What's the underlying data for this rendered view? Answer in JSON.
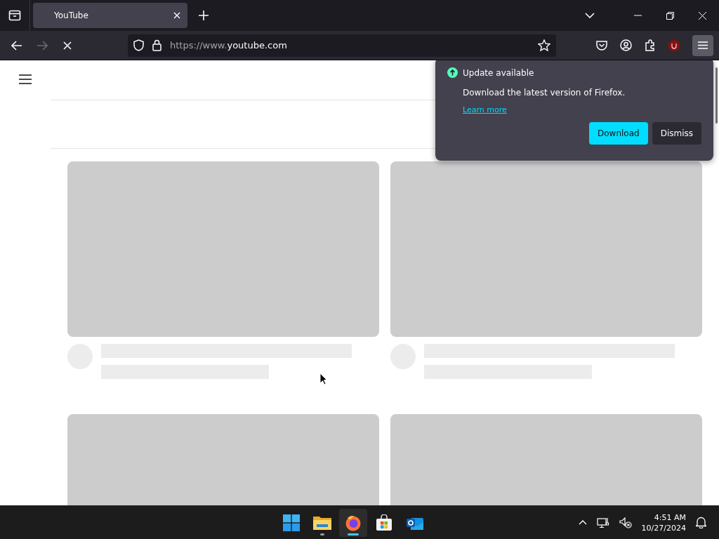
{
  "tabs": [
    {
      "title": "YouTube",
      "selected": true
    }
  ],
  "toolbar": {
    "url_prefix": "https://www.",
    "url_host": "youtube.com",
    "loading": true
  },
  "feed": {
    "cards": [
      {
        "kind": "skeleton"
      },
      {
        "kind": "skeleton"
      },
      {
        "kind": "thumbnail_only"
      },
      {
        "kind": "thumbnail_only"
      }
    ]
  },
  "update_popup": {
    "title": "Update available",
    "message": "Download the latest version of Firefox.",
    "link": "Learn more",
    "buttons": [
      {
        "label": "Download",
        "kind": "primary"
      },
      {
        "label": "Dismiss",
        "kind": "secondary"
      }
    ]
  },
  "taskbar": {
    "apps": [
      {
        "kind": "start",
        "selected": false,
        "running": false
      },
      {
        "kind": "files",
        "selected": false,
        "running": true
      },
      {
        "kind": "browser",
        "selected": true,
        "running": true
      },
      {
        "kind": "store",
        "selected": false,
        "running": false
      },
      {
        "kind": "mail",
        "selected": false,
        "running": false
      }
    ],
    "time": "4:51 AM",
    "date": "10/27/2024"
  }
}
